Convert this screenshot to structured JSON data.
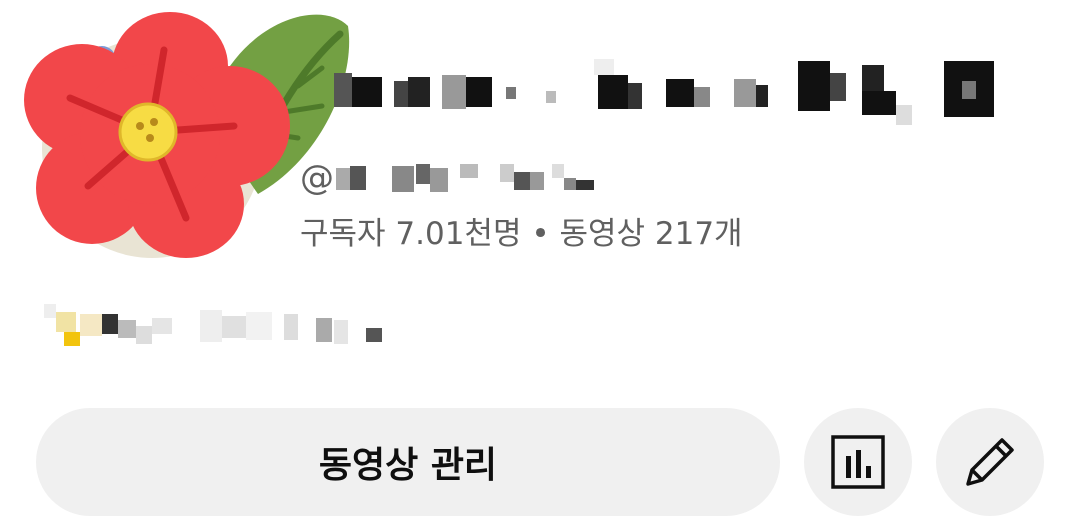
{
  "channel": {
    "handle_prefix": "@",
    "stats": "구독자 7.01천명 • 동영상 217개"
  },
  "actions": {
    "manage_videos_label": "동영상 관리",
    "analytics_icon": "bar-chart-icon",
    "edit_icon": "pencil-icon"
  },
  "avatar": {
    "description_icon": "hibiscus-flower-icon"
  },
  "colors": {
    "background": "#ffffff",
    "button_bg": "#f0f0f0",
    "secondary_text": "#606060",
    "primary_text": "#0f0f0f",
    "flower_red": "#f2474a",
    "leaf_green": "#6b9a3a"
  }
}
